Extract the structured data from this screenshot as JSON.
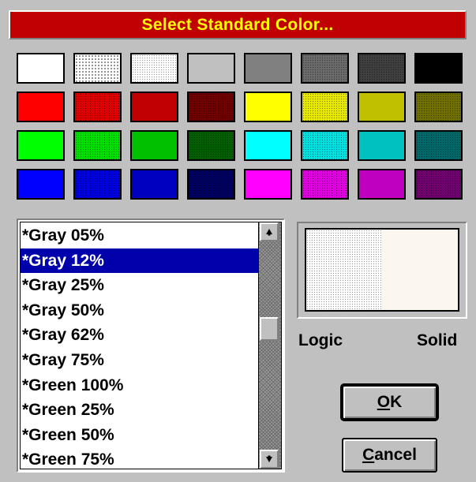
{
  "dialog": {
    "title": "Select Standard Color..."
  },
  "palette": {
    "rows": [
      [
        {
          "color": "#ffffff",
          "pattern": "none"
        },
        {
          "color": "#ffffff",
          "pattern": "dots-sparse"
        },
        {
          "color": "#ffffff",
          "pattern": "dots-dense"
        },
        {
          "color": "#c0c0c0",
          "pattern": "none"
        },
        {
          "color": "#808080",
          "pattern": "none"
        },
        {
          "color": "#6b6b6b",
          "pattern": "dots-dark"
        },
        {
          "color": "#404040",
          "pattern": "dots-dark"
        },
        {
          "color": "#000000",
          "pattern": "none"
        }
      ],
      [
        {
          "color": "#ff0000",
          "pattern": "none"
        },
        {
          "color": "#e00000",
          "pattern": "dots-dark"
        },
        {
          "color": "#c00000",
          "pattern": "none"
        },
        {
          "color": "#700000",
          "pattern": "dots-dark"
        },
        {
          "color": "#ffff00",
          "pattern": "none"
        },
        {
          "color": "#e8e800",
          "pattern": "dots-dark"
        },
        {
          "color": "#c0c000",
          "pattern": "none"
        },
        {
          "color": "#707000",
          "pattern": "dots-dark"
        }
      ],
      [
        {
          "color": "#00ff00",
          "pattern": "none"
        },
        {
          "color": "#00e000",
          "pattern": "dots-dark"
        },
        {
          "color": "#00c000",
          "pattern": "none"
        },
        {
          "color": "#006000",
          "pattern": "dots-dark"
        },
        {
          "color": "#00ffff",
          "pattern": "none"
        },
        {
          "color": "#00e0e0",
          "pattern": "dots-dark"
        },
        {
          "color": "#00c0c0",
          "pattern": "none"
        },
        {
          "color": "#006868",
          "pattern": "dots-dark"
        }
      ],
      [
        {
          "color": "#0000ff",
          "pattern": "none"
        },
        {
          "color": "#0000e0",
          "pattern": "dots-dark"
        },
        {
          "color": "#0000c0",
          "pattern": "none"
        },
        {
          "color": "#000060",
          "pattern": "dots-dark"
        },
        {
          "color": "#ff00ff",
          "pattern": "none"
        },
        {
          "color": "#e000e0",
          "pattern": "dots-dark"
        },
        {
          "color": "#c000c0",
          "pattern": "none"
        },
        {
          "color": "#700070",
          "pattern": "dots-dark"
        }
      ]
    ]
  },
  "color_list": {
    "items": [
      "*Gray 05%",
      "*Gray 12%",
      "*Gray 25%",
      "*Gray 50%",
      "*Gray 62%",
      "*Gray 75%",
      "*Green 100%",
      "*Green 25%",
      "*Green 50%",
      "*Green 75%"
    ],
    "selected_index": 1,
    "scroll_up_glyph": "▲",
    "scroll_down_glyph": "▼",
    "up_icon": "arrow-up-icon",
    "down_icon": "arrow-down-icon"
  },
  "preview": {
    "logic_label": "Logic",
    "solid_label": "Solid"
  },
  "buttons": {
    "ok_prefix": "",
    "ok_mnemonic": "O",
    "ok_rest": "K",
    "cancel_mnemonic": "C",
    "cancel_rest": "ancel"
  },
  "colors": {
    "title_bg": "#c00000",
    "title_fg": "#ffff00",
    "selection_bg": "#0000aa",
    "dialog_bg": "#c0c0c0"
  }
}
